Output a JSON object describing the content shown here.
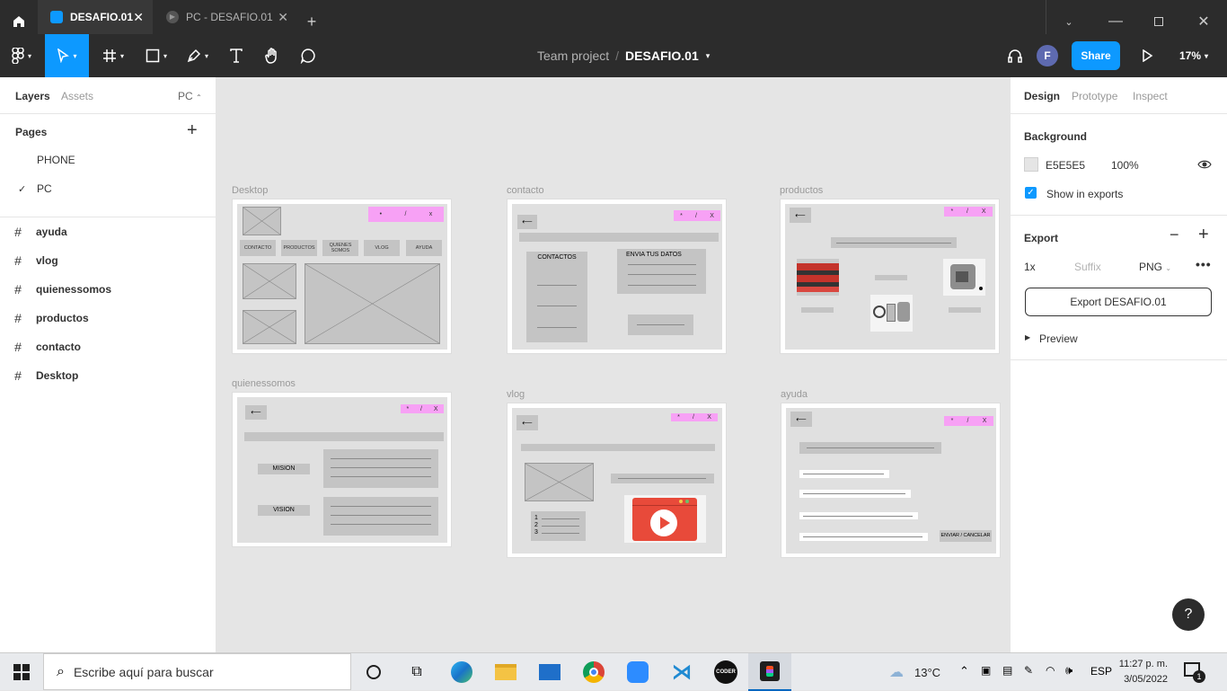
{
  "tabs": [
    {
      "label": "DESAFIO.01",
      "active": true
    },
    {
      "label": "PC - DESAFIO.01",
      "active": false
    }
  ],
  "toolbar": {
    "project": "Team project",
    "separator": "/",
    "file": "DESAFIO.01",
    "avatar_initial": "F",
    "share_label": "Share",
    "zoom": "17%"
  },
  "left": {
    "tab_layers": "Layers",
    "tab_assets": "Assets",
    "page_selector": "PC",
    "pages_title": "Pages",
    "pages": [
      "PHONE",
      "PC"
    ],
    "selected_page": "PC",
    "layers": [
      "ayuda",
      "vlog",
      "quienessomos",
      "productos",
      "contacto",
      "Desktop"
    ]
  },
  "right": {
    "tab_design": "Design",
    "tab_prototype": "Prototype",
    "tab_inspect": "Inspect",
    "background_title": "Background",
    "bg_hex": "E5E5E5",
    "bg_opacity": "100%",
    "show_in_exports": "Show in exports",
    "export_title": "Export",
    "export_scale": "1x",
    "export_suffix_placeholder": "Suffix",
    "export_format": "PNG",
    "export_button": "Export DESAFIO.01",
    "preview_label": "Preview"
  },
  "canvas": {
    "frames": {
      "desktop": {
        "label": "Desktop",
        "nav": [
          "CONTACTO",
          "PRODUCTOS",
          "QUIENES SOMOS",
          "VLOG",
          "AYUDA"
        ],
        "window_controls": [
          "•",
          "/",
          "x"
        ]
      },
      "contacto": {
        "label": "contacto",
        "contactos": "CONTACTOS",
        "envia": "ENVIA TUS DATOS",
        "window_controls": [
          "*",
          "/",
          "X"
        ]
      },
      "productos": {
        "label": "productos",
        "window_controls": [
          "*",
          "/",
          "X"
        ]
      },
      "quienessomos": {
        "label": "quienessomos",
        "mision": "MISION",
        "vision": "VISION",
        "window_controls": [
          "*",
          "/",
          "X"
        ]
      },
      "vlog": {
        "label": "vlog",
        "list": [
          "1",
          "2",
          "3"
        ],
        "window_controls": [
          "*",
          "/",
          "X"
        ]
      },
      "ayuda": {
        "label": "ayuda",
        "submit": "ENVIAR / CANCELAR",
        "window_controls": [
          "*",
          "/",
          "X"
        ]
      }
    },
    "help_button": "?"
  },
  "taskbar": {
    "search_placeholder": "Escribe aquí para buscar",
    "weather": "13°C",
    "lang": "ESP",
    "time": "11:27 p. m.",
    "date": "3/05/2022",
    "notif_count": "1",
    "coder_label": "CODER"
  },
  "colors": {
    "accent": "#0d99ff",
    "dark": "#2c2c2c",
    "pink": "#f7a1f5"
  }
}
